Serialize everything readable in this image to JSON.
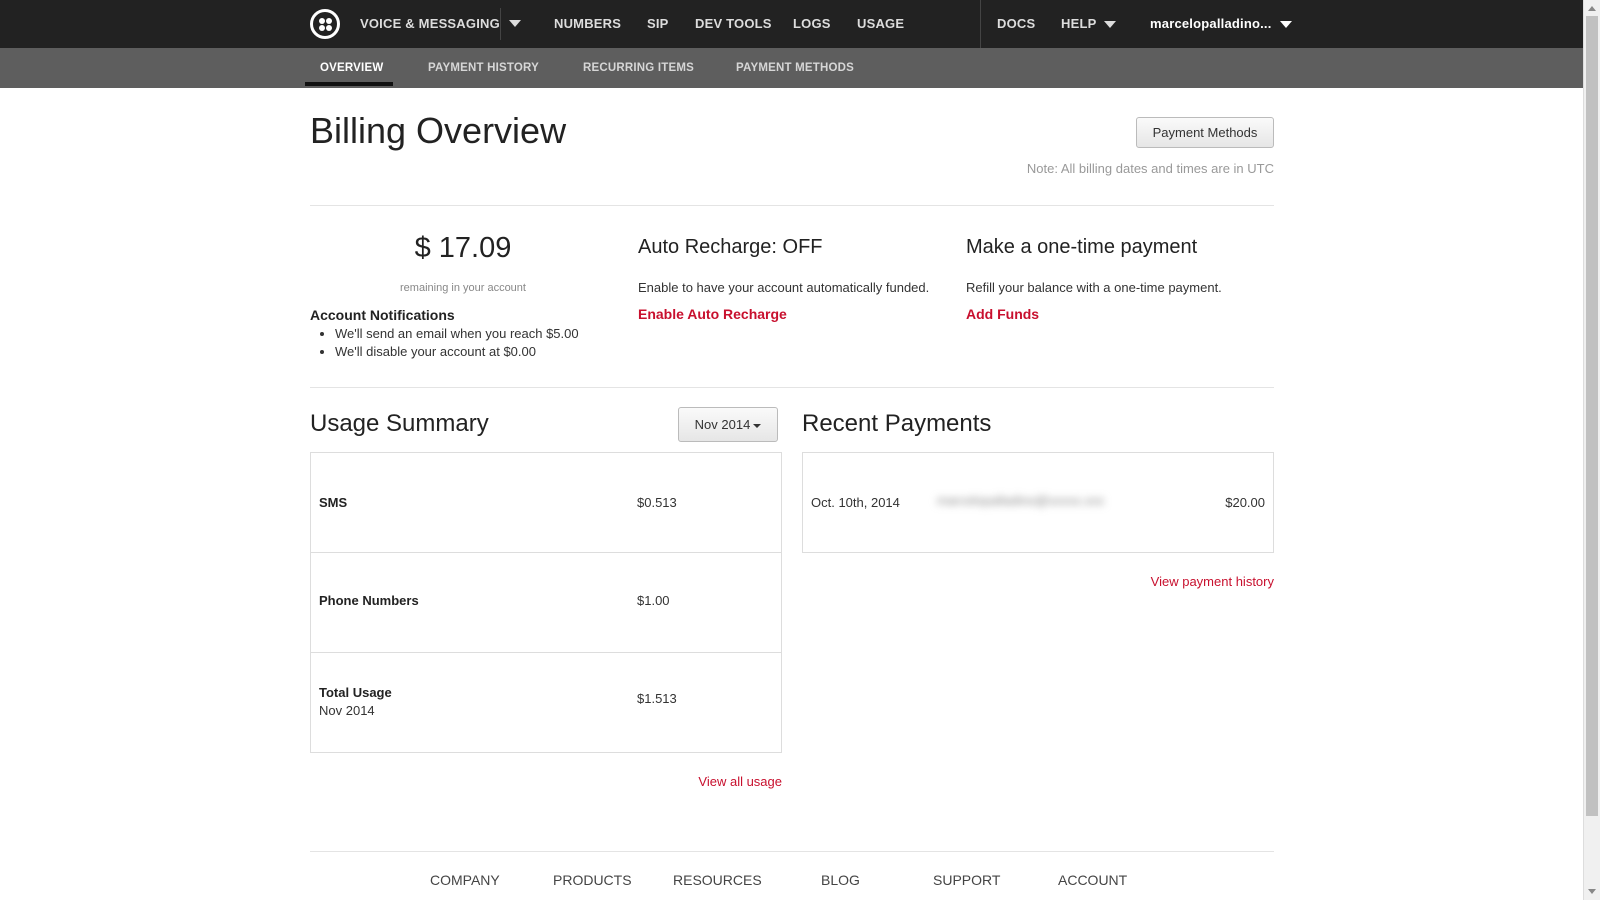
{
  "topnav": {
    "product": "VOICE & MESSAGING",
    "items": [
      "NUMBERS",
      "SIP",
      "DEV TOOLS",
      "LOGS",
      "USAGE"
    ],
    "docs": "DOCS",
    "help": "HELP",
    "user": "marcelopalladino..."
  },
  "subnav": {
    "tabs": [
      "OVERVIEW",
      "PAYMENT HISTORY",
      "RECURRING ITEMS",
      "PAYMENT METHODS"
    ],
    "active": "OVERVIEW"
  },
  "header": {
    "title": "Billing Overview",
    "payment_methods_button": "Payment Methods",
    "note": "Note: All billing dates and times are in UTC"
  },
  "balance": {
    "amount": "$ 17.09",
    "caption": "remaining in your account",
    "notifications_title": "Account Notifications",
    "notifications": [
      "We'll send an email when you reach $5.00",
      "We'll disable your account at $0.00"
    ]
  },
  "auto_recharge": {
    "title": "Auto Recharge: OFF",
    "text": "Enable to have your account automatically funded.",
    "link": "Enable Auto Recharge"
  },
  "one_time": {
    "title": "Make a one-time payment",
    "text": "Refill your balance with a one-time payment.",
    "link": "Add Funds"
  },
  "usage_summary": {
    "title": "Usage Summary",
    "month_selector": "Nov 2014",
    "rows": [
      {
        "label": "SMS",
        "sub": "",
        "value": "$0.513"
      },
      {
        "label": "Phone Numbers",
        "sub": "",
        "value": "$1.00"
      },
      {
        "label": "Total Usage",
        "sub": "Nov 2014",
        "value": "$1.513"
      }
    ],
    "view_all": "View all usage"
  },
  "recent_payments": {
    "title": "Recent Payments",
    "payments": [
      {
        "date": "Oct. 10th, 2014",
        "email": "marcelopalladino@xxxxx.xxx",
        "amount": "$20.00"
      }
    ],
    "view_history": "View payment history"
  },
  "footer": {
    "links": [
      "COMPANY",
      "PRODUCTS",
      "RESOURCES",
      "BLOG",
      "SUPPORT",
      "ACCOUNT"
    ]
  },
  "colors": {
    "topnav_bg": "#222222",
    "subnav_bg": "#5e5e5e",
    "link_red": "#c8102e"
  }
}
